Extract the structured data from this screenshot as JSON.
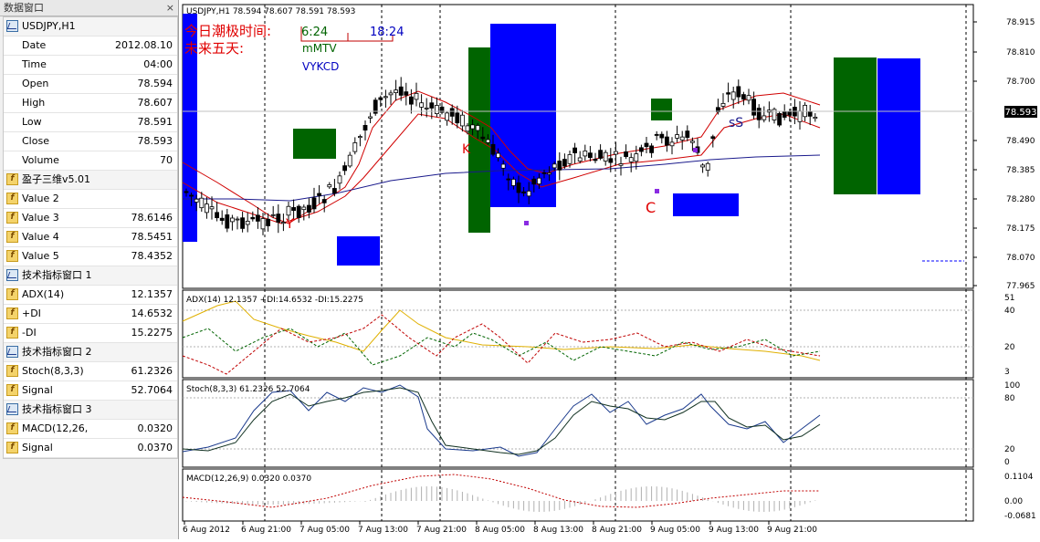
{
  "data_window": {
    "title": "数据窗口",
    "close_glyph": "×",
    "symbol_row": "USDJPY,H1",
    "fields": [
      {
        "label": "Date",
        "value": "2012.08.10"
      },
      {
        "label": "Time",
        "value": "04:00"
      },
      {
        "label": "Open",
        "value": "78.594"
      },
      {
        "label": "High",
        "value": "78.607"
      },
      {
        "label": "Low",
        "value": "78.591"
      },
      {
        "label": "Close",
        "value": "78.593"
      },
      {
        "label": "Volume",
        "value": "70"
      }
    ],
    "indicator1": {
      "name": "盈子三维v5.01",
      "rows": [
        {
          "label": "Value 2",
          "value": ""
        },
        {
          "label": "Value 3",
          "value": "78.6146"
        },
        {
          "label": "Value 4",
          "value": "78.5451"
        },
        {
          "label": "Value 5",
          "value": "78.4352"
        }
      ]
    },
    "window1": {
      "name": "技术指标窗口 1",
      "rows": [
        {
          "label": "ADX(14)",
          "value": "12.1357"
        },
        {
          "label": "+DI",
          "value": "14.6532"
        },
        {
          "label": "-DI",
          "value": "15.2275"
        }
      ]
    },
    "window2": {
      "name": "技术指标窗口 2",
      "rows": [
        {
          "label": "Stoch(8,3,3)",
          "value": "61.2326"
        },
        {
          "label": "Signal",
          "value": "52.7064"
        }
      ]
    },
    "window3": {
      "name": "技术指标窗口 3",
      "rows": [
        {
          "label": "MACD(12,26,",
          "value": "0.0320"
        },
        {
          "label": "Signal",
          "value": "0.0370"
        }
      ]
    }
  },
  "chart": {
    "header": "USDJPY,H1  78.594 78.607 78.591 78.593",
    "current_price": "78.593",
    "tide_line1": "今日潮极时间:",
    "tide_line2": "未来五天:",
    "time_a": "6:24",
    "time_b": "18:24",
    "label_mmtv": "mMTV",
    "label_vykcd": "VYKCD",
    "marker_y": "Y",
    "marker_k": "K",
    "marker_c": "C",
    "marker_ss": "sS",
    "price_ticks": [
      "78.915",
      "78.810",
      "78.700",
      "78.593",
      "78.490",
      "78.385",
      "78.280",
      "78.175",
      "78.070",
      "77.965"
    ],
    "adx_header": "ADX(14) 12.1357 +DI:14.6532 -DI:15.2275",
    "adx_ticks": [
      "51",
      "40",
      "20",
      "3"
    ],
    "stoch_header": "Stoch(8,3,3) 61.2326 52.7064",
    "stoch_ticks": [
      "100",
      "80",
      "20",
      "0"
    ],
    "macd_header": "MACD(12,26,9) 0.0320 0.0370",
    "macd_ticks": [
      "0.1104",
      "0.00",
      "-0.0681"
    ],
    "time_ticks": [
      "6 Aug 2012",
      "6 Aug 21:00",
      "7 Aug 05:00",
      "7 Aug 13:00",
      "7 Aug 21:00",
      "8 Aug 05:00",
      "8 Aug 13:00",
      "8 Aug 21:00",
      "9 Aug 05:00",
      "9 Aug 13:00",
      "9 Aug 21:00"
    ],
    "colors": {
      "blue_box": "#0000ff",
      "green_box": "#006400",
      "bull_candle": "#ffffff",
      "bear_candle": "#000000",
      "ma_red": "#d00000",
      "ma_blue": "#1a1a8c",
      "adx_yellow": "#e0b000",
      "di_green": "#006400",
      "di_red": "#c00000",
      "stoch_main": "#1a3a8c",
      "stoch_sig": "#103020",
      "macd_hist": "#b0b0b0",
      "macd_sig": "#c00000",
      "text_red": "#e00000",
      "text_green": "#006400",
      "text_blue": "#0000c0",
      "marker_purple": "#8a2be2"
    }
  }
}
